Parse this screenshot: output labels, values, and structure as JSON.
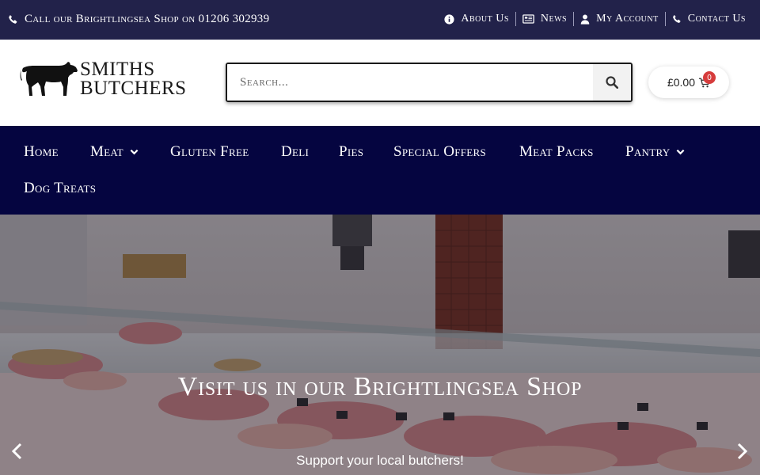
{
  "topbar": {
    "call_text": "Call our Brightlingsea Shop on 01206 302939",
    "links": [
      {
        "label": "About Us",
        "icon": "info-icon"
      },
      {
        "label": "News",
        "icon": "newspaper-icon"
      },
      {
        "label": "My Account",
        "icon": "user-icon"
      },
      {
        "label": "Contact Us",
        "icon": "phone-icon"
      }
    ]
  },
  "header": {
    "logo_line1": "SMITHS",
    "logo_line2": "BUTCHERS",
    "search_placeholder": "Search...",
    "cart_total": "£0.00",
    "cart_count": "0"
  },
  "nav": {
    "items": [
      {
        "label": "Home",
        "has_dropdown": false
      },
      {
        "label": "Meat",
        "has_dropdown": true
      },
      {
        "label": "Gluten Free",
        "has_dropdown": false
      },
      {
        "label": "Deli",
        "has_dropdown": false
      },
      {
        "label": "Pies",
        "has_dropdown": false
      },
      {
        "label": "Special Offers",
        "has_dropdown": false
      },
      {
        "label": "Meat Packs",
        "has_dropdown": false
      },
      {
        "label": "Pantry",
        "has_dropdown": true
      },
      {
        "label": "Dog Treats",
        "has_dropdown": false
      }
    ]
  },
  "hero": {
    "title": "Visit us in our Brightlingsea Shop",
    "subtitle": "Support your local butchers!"
  },
  "colors": {
    "topbar_bg": "#22224a",
    "nav_bg": "#050540",
    "cart_badge": "#d63c3c"
  }
}
